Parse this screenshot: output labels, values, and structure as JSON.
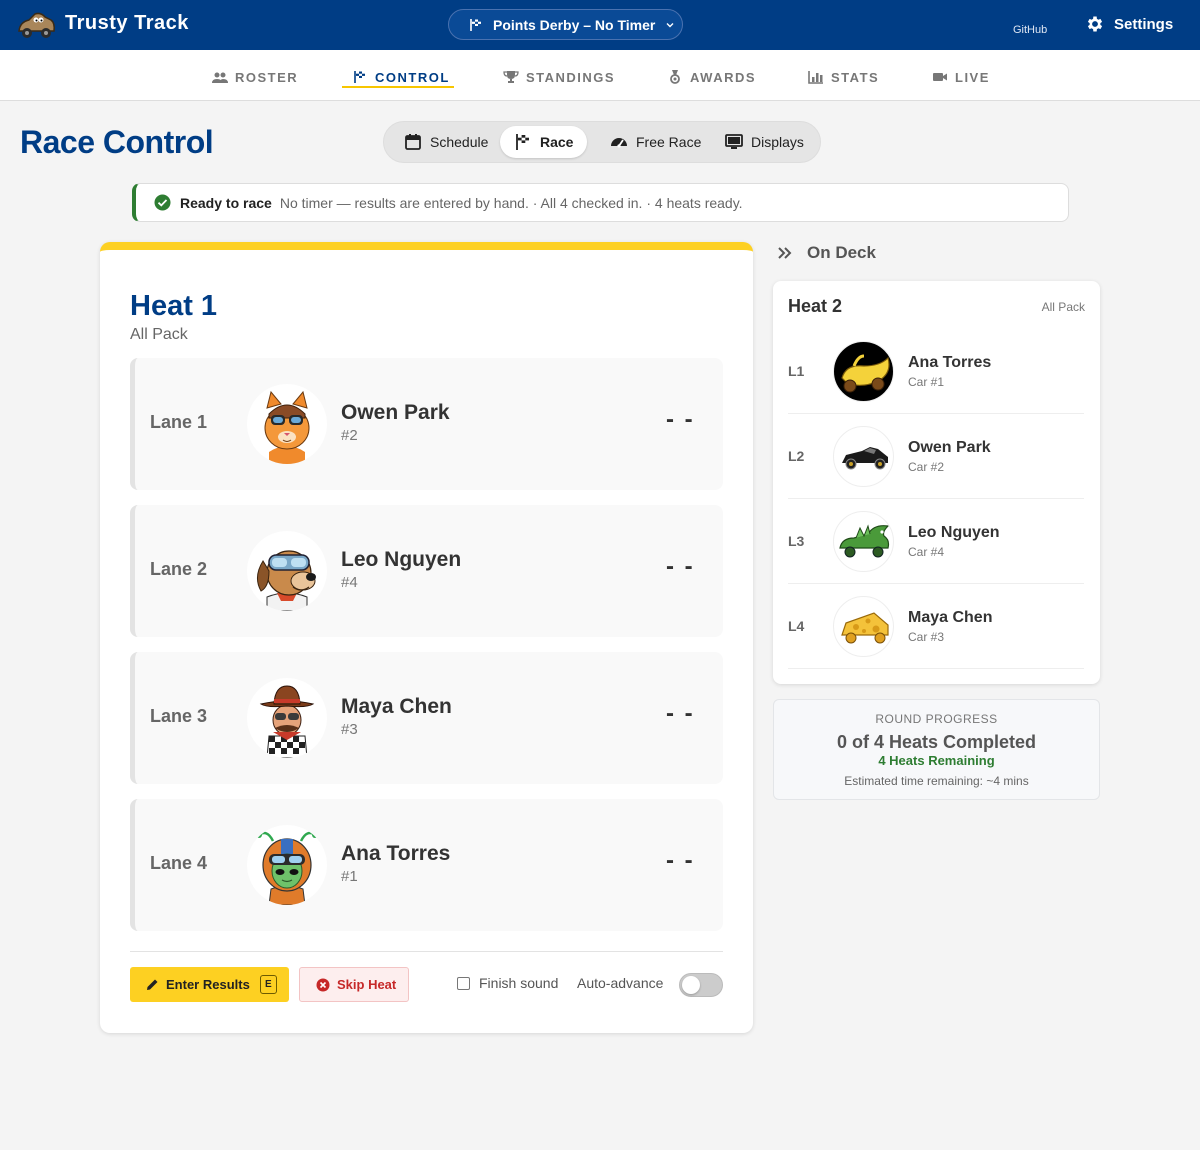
{
  "app": {
    "title": "Trusty Track",
    "github": "GitHub",
    "settings": "Settings"
  },
  "event": {
    "selected": "Points Derby – No Timer"
  },
  "nav": {
    "tabs": [
      {
        "label": "ROSTER",
        "icon": "people-icon"
      },
      {
        "label": "CONTROL",
        "icon": "flag-icon",
        "active": true
      },
      {
        "label": "STANDINGS",
        "icon": "trophy-icon"
      },
      {
        "label": "AWARDS",
        "icon": "medal-icon"
      },
      {
        "label": "STATS",
        "icon": "bar-chart-icon"
      },
      {
        "label": "LIVE",
        "icon": "video-icon"
      }
    ]
  },
  "page": {
    "title": "Race Control"
  },
  "modes": [
    {
      "label": "Schedule",
      "icon": "calendar-icon"
    },
    {
      "label": "Race",
      "icon": "flag-icon",
      "active": true
    },
    {
      "label": "Free Race",
      "icon": "speedometer-icon"
    },
    {
      "label": "Displays",
      "icon": "monitor-icon"
    }
  ],
  "status": {
    "title": "Ready to race",
    "detail": "No timer — results are entered by hand. · All 4 checked in. · 4 heats ready."
  },
  "heat": {
    "title": "Heat 1",
    "subtitle": "All Pack",
    "lanes": [
      {
        "lane": "Lane 1",
        "name": "Owen Park",
        "number": "#2",
        "time": "- -",
        "avatar": "cat-racer-avatar"
      },
      {
        "lane": "Lane 2",
        "name": "Leo Nguyen",
        "number": "#4",
        "time": "- -",
        "avatar": "dog-racer-avatar"
      },
      {
        "lane": "Lane 3",
        "name": "Maya Chen",
        "number": "#3",
        "time": "- -",
        "avatar": "cowboy-racer-avatar"
      },
      {
        "lane": "Lane 4",
        "name": "Ana Torres",
        "number": "#1",
        "time": "- -",
        "avatar": "alien-racer-avatar"
      }
    ],
    "enter_results": "Enter Results",
    "enter_key": "E",
    "skip": "Skip Heat",
    "finish_sound": "Finish sound",
    "auto_advance": "Auto-advance"
  },
  "on_deck": {
    "header": "On Deck",
    "title": "Heat 2",
    "subtitle": "All Pack",
    "rows": [
      {
        "lane": "L1",
        "name": "Ana Torres",
        "car": "Car #1",
        "avatar": "banana-car-icon"
      },
      {
        "lane": "L2",
        "name": "Owen Park",
        "car": "Car #2",
        "avatar": "black-car-icon"
      },
      {
        "lane": "L3",
        "name": "Leo Nguyen",
        "car": "Car #4",
        "avatar": "dragon-car-icon"
      },
      {
        "lane": "L4",
        "name": "Maya Chen",
        "car": "Car #3",
        "avatar": "cheese-car-icon"
      }
    ]
  },
  "progress": {
    "label": "ROUND PROGRESS",
    "main": "0 of 4 Heats Completed",
    "remaining": "4 Heats Remaining",
    "estimate": "Estimated time remaining: ~4 mins"
  },
  "colors": {
    "brand": "#003d85",
    "accent": "#fdd022",
    "success": "#2e7d32",
    "danger": "#c62828"
  }
}
